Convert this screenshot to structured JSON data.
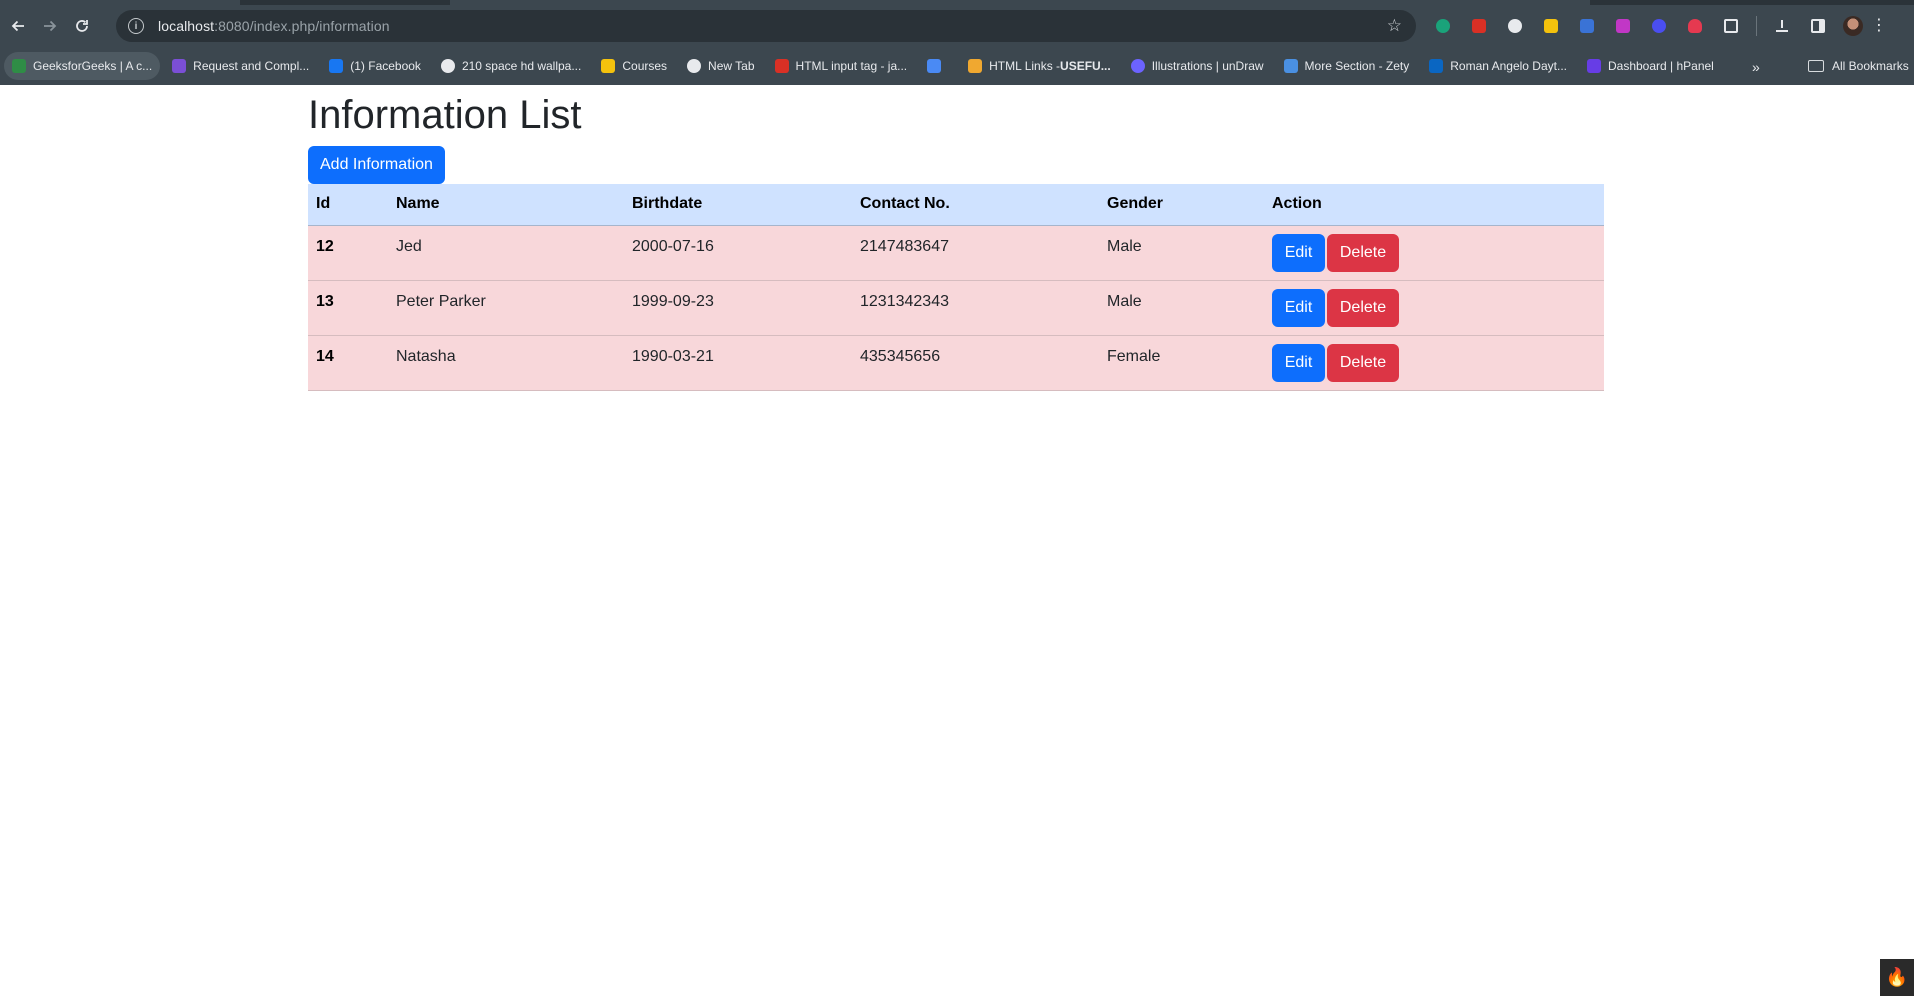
{
  "browser": {
    "url_host": "localhost",
    "url_rest": ":8080/index.php/information",
    "bookmarks": [
      {
        "label": "GeeksforGeeks | A c...",
        "color": "#2f8d46"
      },
      {
        "label": "Request and Compl...",
        "color": "#7b4fd6"
      },
      {
        "label": "(1) Facebook",
        "color": "#1877f2"
      },
      {
        "label": "210 space hd wallpa...",
        "color": "#e8eaed"
      },
      {
        "label": "Courses",
        "color": "#f4c20d"
      },
      {
        "label": "New Tab",
        "color": "#e8eaed"
      },
      {
        "label": "HTML input tag - ja...",
        "color": "#d93025"
      },
      {
        "label": "",
        "color": "#4a8af4"
      },
      {
        "label_prefix": "HTML Links - ",
        "label_bold": "USEFU...",
        "color": "#f0a830"
      },
      {
        "label": "Illustrations | unDraw",
        "color": "#6c63ff"
      },
      {
        "label": "More Section - Zety",
        "color": "#4a90e2"
      },
      {
        "label": "Roman Angelo Dayt...",
        "color": "#0a66c2"
      },
      {
        "label": "Dashboard | hPanel",
        "color": "#673de6"
      }
    ],
    "all_bookmarks": "All Bookmarks",
    "more_glyph": "»"
  },
  "page": {
    "title": "Information List",
    "add_button": "Add Information",
    "table": {
      "headers": [
        "Id",
        "Name",
        "Birthdate",
        "Contact No.",
        "Gender",
        "Action"
      ],
      "rows": [
        {
          "id": "12",
          "name": "Jed",
          "birthdate": "2000-07-16",
          "contact": "2147483647",
          "gender": "Male"
        },
        {
          "id": "13",
          "name": "Peter Parker",
          "birthdate": "1999-09-23",
          "contact": "1231342343",
          "gender": "Male"
        },
        {
          "id": "14",
          "name": "Natasha",
          "birthdate": "1990-03-21",
          "contact": "435345656",
          "gender": "Female"
        }
      ],
      "edit_label": "Edit",
      "delete_label": "Delete"
    }
  },
  "colors": {
    "primary": "#0d6efd",
    "danger": "#dc3545",
    "header_row": "#cfe2ff",
    "body_row": "#f8d7da"
  }
}
